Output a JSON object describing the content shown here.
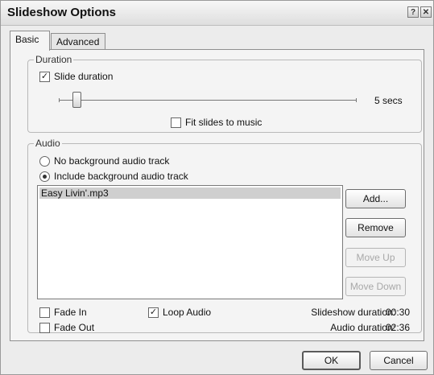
{
  "window": {
    "title": "Slideshow Options",
    "help_glyph": "?",
    "close_glyph": "✕"
  },
  "tabs": [
    {
      "label": "Basic",
      "active": true
    },
    {
      "label": "Advanced",
      "active": false
    }
  ],
  "duration_group": {
    "label": "Duration",
    "slide_duration_checkbox": {
      "label": "Slide duration",
      "checked": true
    },
    "slider_value_text": "5 secs",
    "slider_level_fraction": 0.06,
    "fit_to_music_checkbox": {
      "label": "Fit slides to music",
      "checked": false
    }
  },
  "audio_group": {
    "label": "Audio",
    "radio_none": {
      "label": "No background audio track",
      "selected": false
    },
    "radio_include": {
      "label": "Include background audio track",
      "selected": true
    },
    "tracks": [
      "Easy Livin'.mp3"
    ],
    "buttons": {
      "add": "Add...",
      "remove": "Remove",
      "move_up": "Move Up",
      "move_down": "Move Down"
    },
    "fade_in": {
      "label": "Fade In",
      "checked": false
    },
    "fade_out": {
      "label": "Fade Out",
      "checked": false
    },
    "loop_audio": {
      "label": "Loop Audio",
      "checked": true
    },
    "slideshow_duration": {
      "label": "Slideshow duration:",
      "value": "00:30"
    },
    "audio_duration": {
      "label": "Audio duration:",
      "value": "02:36"
    }
  },
  "footer": {
    "ok": "OK",
    "cancel": "Cancel"
  }
}
